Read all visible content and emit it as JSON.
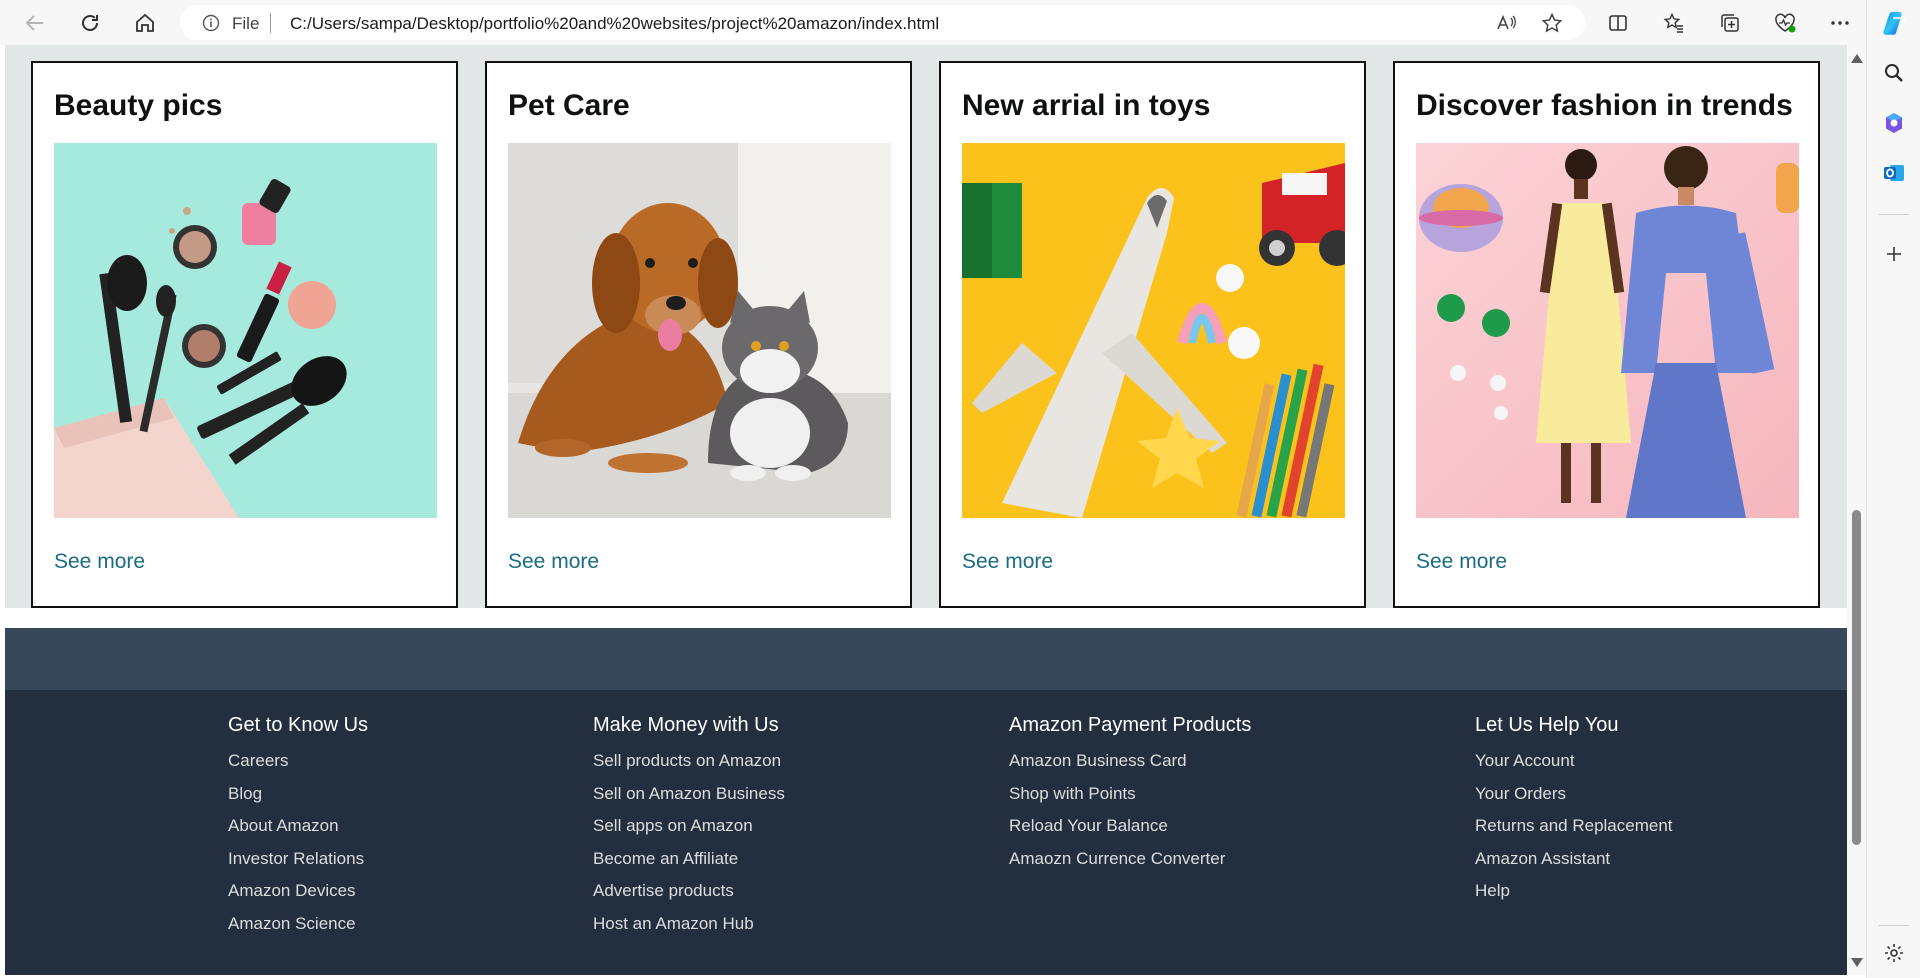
{
  "browser": {
    "address": {
      "file_label": "File",
      "url": "C:/Users/sampa/Desktop/portfolio%20and%20websites/project%20amazon/index.html"
    }
  },
  "cards": [
    {
      "title": "Beauty pics",
      "link": "See more"
    },
    {
      "title": "Pet Care",
      "link": "See more"
    },
    {
      "title": "New arrial in toys",
      "link": "See more"
    },
    {
      "title": "Discover fashion in trends",
      "link": "See more"
    }
  ],
  "footer": {
    "columns": [
      {
        "heading": "Get to Know Us",
        "links": [
          "Careers",
          "Blog",
          "About Amazon",
          "Investor Relations",
          "Amazon Devices",
          "Amazon Science"
        ]
      },
      {
        "heading": "Make Money with Us",
        "links": [
          "Sell products on Amazon",
          "Sell on Amazon Business",
          "Sell apps on Amazon",
          "Become an Affiliate",
          "Advertise products",
          "Host an Amazon Hub"
        ]
      },
      {
        "heading": "Amazon Payment Products",
        "links": [
          "Amazon Business Card",
          "Shop with Points",
          "Reload Your Balance",
          "Amaozn Currence Converter"
        ]
      },
      {
        "heading": "Let Us Help You",
        "links": [
          "Your Account",
          "Your Orders",
          "Returns and Replacement",
          "Amazon Assistant",
          "Help"
        ]
      }
    ]
  },
  "colors": {
    "page_bg": "#e3e6e6",
    "link": "#1a6c84",
    "footer_top": "#37475a",
    "footer": "#232f3e"
  }
}
